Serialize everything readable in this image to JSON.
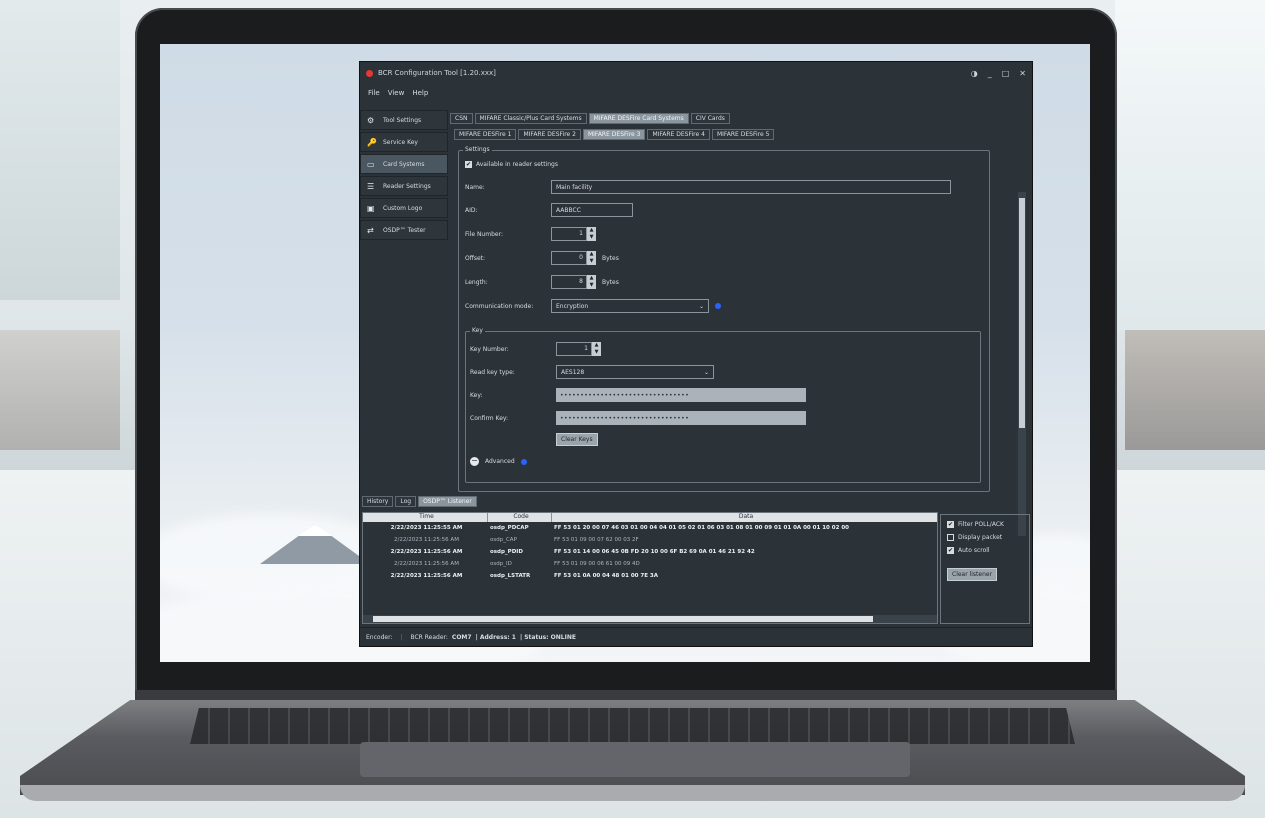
{
  "window": {
    "title": "BCR Configuration Tool [1.20.xxx]",
    "controls": [
      "◑",
      "_",
      "□",
      "✕"
    ]
  },
  "menu": [
    "File",
    "View",
    "Help"
  ],
  "sidebar": [
    {
      "label": "Tool Settings",
      "icon": "⚙"
    },
    {
      "label": "Service Key",
      "icon": "🔑"
    },
    {
      "label": "Card Systems",
      "icon": "▭"
    },
    {
      "label": "Reader Settings",
      "icon": "☰"
    },
    {
      "label": "Custom Logo",
      "icon": "▣"
    },
    {
      "label": "OSDP™ Tester",
      "icon": "⇄"
    }
  ],
  "tabs_top": [
    "CSN",
    "MIFARE Classic/Plus Card Systems",
    "MIFARE DESFire Card Systems",
    "CIV Cards"
  ],
  "tabs_sub": [
    "MIFARE DESFire 1",
    "MIFARE DESFire 2",
    "MIFARE DESFire 3",
    "MIFARE DESFire 4",
    "MIFARE DESFire 5"
  ],
  "settings": {
    "legend": "Settings",
    "available": "Available in reader settings",
    "name_label": "Name:",
    "name_value": "Main facility",
    "aid_label": "AID:",
    "aid_value": "AABBCC",
    "file_number_label": "File Number:",
    "file_number_value": "1",
    "offset_label": "Offset:",
    "offset_value": "0",
    "offset_unit": "Bytes",
    "length_label": "Length:",
    "length_value": "8",
    "length_unit": "Bytes",
    "comm_mode_label": "Communication mode:",
    "comm_mode_value": "Encryption"
  },
  "key": {
    "legend": "Key",
    "key_number_label": "Key Number:",
    "key_number_value": "1",
    "read_key_type_label": "Read key type:",
    "read_key_type_value": "AES128",
    "key_label": "Key:",
    "key_value": "••••••••••••••••••••••••••••••••",
    "confirm_key_label": "Confirm Key:",
    "confirm_key_value": "••••••••••••••••••••••••••••••••",
    "clear_keys": "Clear Keys"
  },
  "advanced": "Advanced",
  "log_tabs": [
    "History",
    "Log",
    "OSDP™ Listener"
  ],
  "log": {
    "columns": [
      "Time",
      "Code",
      "Data"
    ],
    "rows": [
      {
        "time": "2/22/2023 11:25:55 AM",
        "code": "osdp_PDCAP",
        "data": "FF 53 01 20 00 07 46 03 01 00 04 04 01 05 02 01 06 03 01 08 01 00 09 01 01 0A 00 01 10 02 00",
        "bold": true
      },
      {
        "time": "2/22/2023 11:25:56 AM",
        "code": "osdp_CAP",
        "data": "FF 53 01 09 00 07 62 00 03 2F",
        "bold": false
      },
      {
        "time": "2/22/2023 11:25:56 AM",
        "code": "osdp_PDID",
        "data": "FF 53 01 14 00 06 45 0B FD 20 10 00 6F B2 69 0A 01 46 21 92 42",
        "bold": true
      },
      {
        "time": "2/22/2023 11:25:56 AM",
        "code": "osdp_ID",
        "data": "FF 53 01 09 00 06 61 00 09 4D",
        "bold": false
      },
      {
        "time": "2/22/2023 11:25:56 AM",
        "code": "osdp_LSTATR",
        "data": "FF 53 01 0A 00 04 48 01 00 7E 3A",
        "bold": true
      }
    ]
  },
  "log_options": [
    {
      "label": "Filter POLL/ACK",
      "checked": true
    },
    {
      "label": "Display packet",
      "checked": false
    },
    {
      "label": "Auto scroll",
      "checked": true
    }
  ],
  "clear_listener": "Clear listener",
  "status": {
    "encoder": "Encoder:",
    "reader": "BCR Reader:",
    "port": "COM7",
    "address": "| Address: 1",
    "state": "| Status: ONLINE"
  }
}
